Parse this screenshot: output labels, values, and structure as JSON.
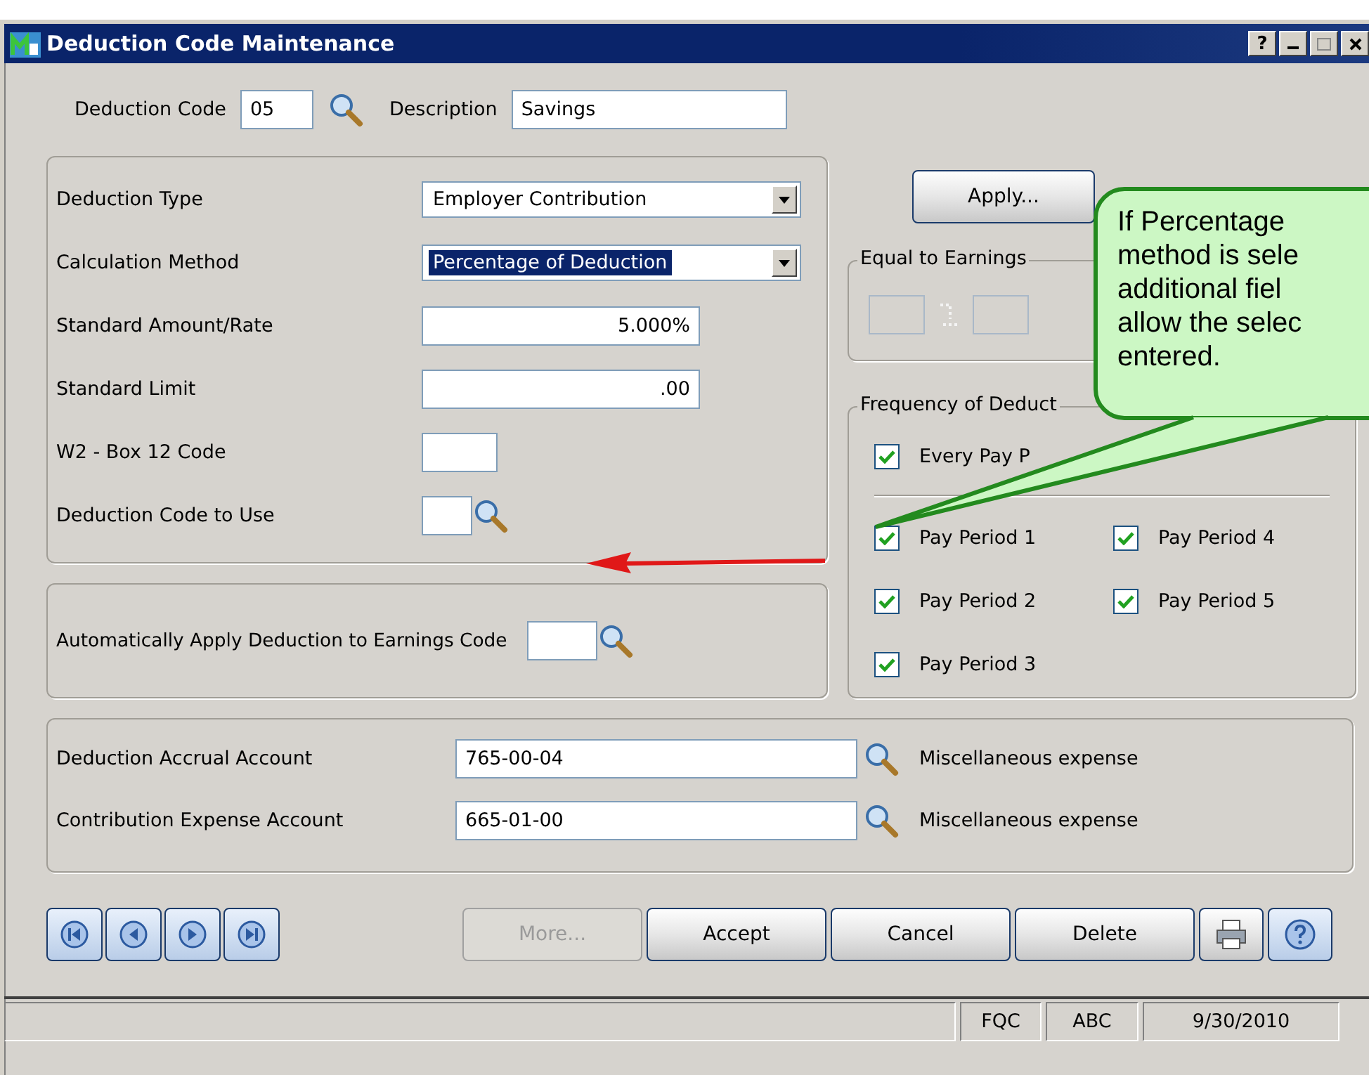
{
  "window": {
    "title": "Deduction Code Maintenance",
    "help": "?"
  },
  "header": {
    "code_label": "Deduction Code",
    "code_value": "05",
    "description_label": "Description",
    "description_value": "Savings"
  },
  "fields": [
    {
      "label": "Deduction Type",
      "kind": "dropdown",
      "value": "Employer Contribution",
      "focused": false
    },
    {
      "label": "Calculation Method",
      "kind": "dropdown",
      "value": "Percentage of Deduction",
      "focused": true
    },
    {
      "label": "Standard Amount/Rate",
      "kind": "number",
      "value": "5.000%"
    },
    {
      "label": "Standard Limit",
      "kind": "number",
      "value": ".00"
    },
    {
      "label": "W2 - Box 12 Code",
      "kind": "short"
    },
    {
      "label": "Deduction Code to Use",
      "kind": "lookup"
    }
  ],
  "apply_button": {
    "label": "Apply..."
  },
  "equal_group": {
    "title": "Equal to Earnings"
  },
  "frequency": {
    "title": "Frequency of Deduct",
    "every": {
      "label": "Every Pay P",
      "checked": true
    },
    "periods": [
      {
        "label": "Pay Period 1",
        "checked": true
      },
      {
        "label": "Pay Period 2",
        "checked": true
      },
      {
        "label": "Pay Period 3",
        "checked": true
      },
      {
        "label": "Pay Period 4",
        "checked": true
      },
      {
        "label": "Pay Period 5",
        "checked": true
      }
    ]
  },
  "auto_apply": {
    "label": "Automatically Apply Deduction to Earnings Code"
  },
  "accounts": [
    {
      "label": "Deduction Accrual Account",
      "value": "765-00-04",
      "description": "Miscellaneous expense"
    },
    {
      "label": "Contribution Expense Account",
      "value": "665-01-00",
      "description": "Miscellaneous expense"
    }
  ],
  "buttons": [
    {
      "label": "More...",
      "disabled": true
    },
    {
      "label": "Accept",
      "disabled": false
    },
    {
      "label": "Cancel",
      "disabled": false
    },
    {
      "label": "Delete",
      "disabled": false
    }
  ],
  "status_bar": {
    "panels": [
      "FQC",
      "ABC",
      "9/30/2010"
    ]
  },
  "callout": {
    "lines": [
      "If Percentage",
      "method is sele",
      "additional fiel",
      "allow the selec",
      "entered."
    ]
  }
}
